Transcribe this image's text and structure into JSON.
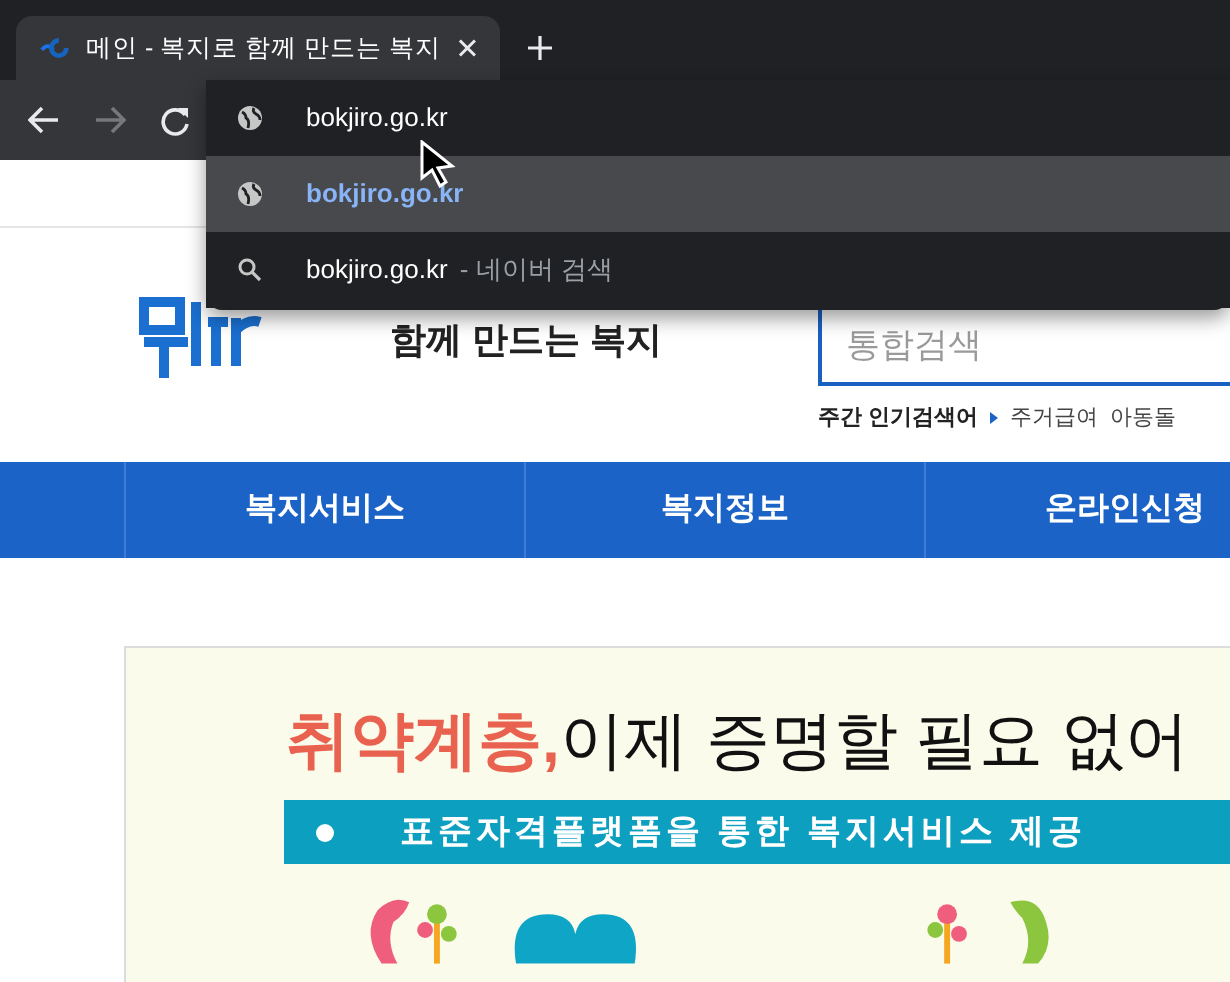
{
  "browser": {
    "tabs": [
      {
        "title": "메인 - 복지로 함께 만드는 복지",
        "selected": true
      }
    ],
    "toolbar": {
      "back_disabled": false,
      "forward_disabled": true
    },
    "omnibox_suggestions": [
      {
        "kind": "url",
        "text": "bokjiro.go.kr",
        "selected": false
      },
      {
        "kind": "url",
        "text": "bokjiro.go.kr",
        "selected": true
      },
      {
        "kind": "search",
        "text": "bokjiro.go.kr",
        "suffix": "- 네이버 검색",
        "selected": false
      }
    ]
  },
  "page": {
    "logo_tagline": "함께 만드는 복지",
    "search": {
      "placeholder": "통합검색"
    },
    "popular": {
      "label": "주간 인기검색어",
      "terms": [
        "주거급여",
        "아동돌"
      ]
    },
    "nav": [
      {
        "label": "복지서비스"
      },
      {
        "label": "복지정보"
      },
      {
        "label": "온라인신청"
      }
    ],
    "banner": {
      "headline_accent": "취약계층,",
      "headline": "이제 증명할 필요 없어",
      "strip": "표준자격플랫폼을 통한 복지서비스 제공"
    }
  }
}
